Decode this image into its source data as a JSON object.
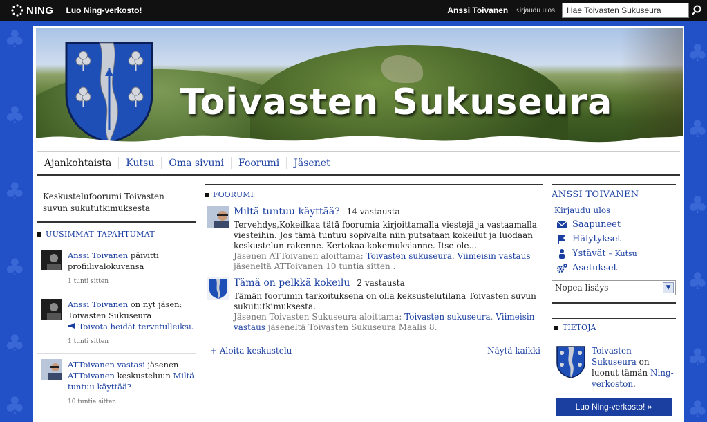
{
  "topbar": {
    "logo": "NING",
    "create_link": "Luo Ning-verkosto!",
    "user_name": "Anssi Toivanen",
    "logout": "Kirjaudu ulos",
    "search_value": "Hae Toivasten Sukuseura"
  },
  "banner": {
    "title": "Toivasten Sukuseura"
  },
  "nav": [
    "Ajankohtaista",
    "Kutsu",
    "Oma sivuni",
    "Foorumi",
    "Jäsenet"
  ],
  "left": {
    "intro": "Keskustelufoorumi Toivasten suvun sukututkimuksesta",
    "events_title": "UUSIMMAT TAPAHTUMAT",
    "events": [
      {
        "actor": "Anssi Toivanen",
        "text": " päivitti profiilivalokuvansa",
        "time": "1 tunti sitten"
      },
      {
        "actor": "Anssi Toivanen",
        "text": " on nyt jäsen: Toivasten Sukuseura",
        "welcome": "Toivota heidät tervetulleiksi.",
        "time": "1 tunti sitten"
      },
      {
        "actor": "ATToivanen",
        "link1": "vastasi",
        "text_mid": " jäsenen ",
        "link2": "ATToivanen",
        "text_after": " keskusteluun ",
        "link3": "Miltä tuntuu käyttää?",
        "time": "10 tuntia sitten"
      }
    ]
  },
  "forum": {
    "title": "FOORUMI",
    "topics": [
      {
        "title": "Miltä tuntuu käyttää?",
        "count": "14 vastausta",
        "body": "Tervehdys,Kokeilkaa tätä foorumia kirjoittamalla viestejä ja vastaamalla viesteihin. Jos tämä tuntuu sopivalta niin putsataan kokeilut ja luodaan keskustelun rakenne. Kertokaa kokemuksianne. Itse ole...",
        "meta_prefix": "Jäsenen ATToivanen aloittama: ",
        "meta_link": "Toivasten sukuseura",
        "meta_sep": ". ",
        "meta_link2": "Viimeisin vastaus",
        "meta_suffix": " jäseneltä ATToivanen 10 tuntia sitten ."
      },
      {
        "title": "Tämä on pelkkä kokeilu",
        "count": "2 vastausta",
        "body": "Tämän foorumin tarkoituksena on olla keksustelutilana Toivasten suvun sukututkimuksesta.",
        "meta_prefix": "Jäsenen Toivasten Sukuseura aloittama: ",
        "meta_link": "Toivasten sukuseura",
        "meta_sep": ". ",
        "meta_link2": "Viimeisin vastaus",
        "meta_suffix": " jäseneltä Toivasten Sukuseura Maalis 8."
      }
    ],
    "add_label": "+ Aloita keskustelu",
    "show_all": "Näytä kaikki"
  },
  "right": {
    "profile_name": "ANSSI TOIVANEN",
    "logout": "Kirjaudu ulos",
    "menu": {
      "inbox": "Saapuneet",
      "alerts": "Hälytykset",
      "friends": "Ystävät",
      "friends_invite": "– Kutsu",
      "settings": "Asetukset"
    },
    "quick_add": "Nopea lisäys",
    "about_title": "TIETOJA",
    "about_link": "Toivasten Sukuseura",
    "about_text": " on luonut tämän ",
    "about_link2": "Ning-verkoston",
    "about_end": ".",
    "cta": "Luo Ning-verkosto! »"
  },
  "colors": {
    "link": "#1a3fa0",
    "background": "#2150c7",
    "topbar": "#111111"
  }
}
